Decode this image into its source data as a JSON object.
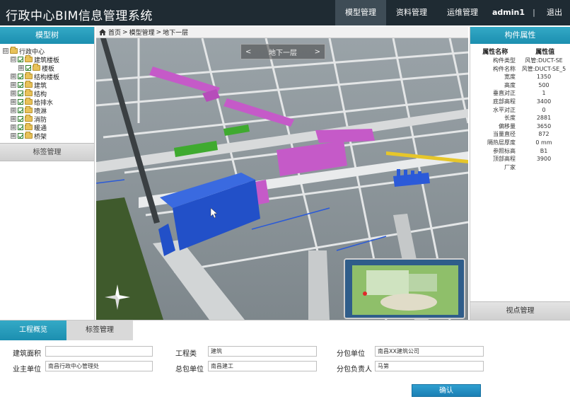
{
  "header": {
    "title": "行政中心BIM信息管理系统",
    "nav": [
      "模型管理",
      "资料管理",
      "运维管理"
    ],
    "active_nav": "模型管理",
    "user": "admin1",
    "separator": "|",
    "logout": "退出"
  },
  "left_panel": {
    "title": "模型树",
    "tree": [
      {
        "label": "行政中心",
        "level": 0,
        "toggle": "⊟",
        "checkbox": false
      },
      {
        "label": "建筑楼板",
        "level": 1,
        "toggle": "⊟",
        "checkbox": true
      },
      {
        "label": "楼板",
        "level": 2,
        "toggle": "⊞",
        "checkbox": true
      },
      {
        "label": "结构楼板",
        "level": 1,
        "toggle": "⊞",
        "checkbox": true
      },
      {
        "label": "建筑",
        "level": 1,
        "toggle": "⊞",
        "checkbox": true
      },
      {
        "label": "结构",
        "level": 1,
        "toggle": "⊞",
        "checkbox": true
      },
      {
        "label": "给排水",
        "level": 1,
        "toggle": "⊞",
        "checkbox": true
      },
      {
        "label": "喷淋",
        "level": 1,
        "toggle": "⊞",
        "checkbox": true
      },
      {
        "label": "消防",
        "level": 1,
        "toggle": "⊞",
        "checkbox": true
      },
      {
        "label": "暖通",
        "level": 1,
        "toggle": "⊞",
        "checkbox": true
      },
      {
        "label": "桥架",
        "level": 1,
        "toggle": "⊞",
        "checkbox": true
      }
    ],
    "tag_manage": "标签管理"
  },
  "breadcrumb": {
    "items": [
      "首页",
      "模型管理",
      "地下一层"
    ],
    "separator": ">"
  },
  "viewport": {
    "floor_label": "地下一层",
    "prev": "<",
    "next": ">"
  },
  "right_panel": {
    "title": "构件属性",
    "col_key": "属性名称",
    "col_val": "属性值",
    "rows": [
      {
        "k": "构件类型",
        "v": "风管:DUCT-SE"
      },
      {
        "k": "构件名称",
        "v": "风管:DUCT-SE_5"
      },
      {
        "k": "宽度",
        "v": "1350"
      },
      {
        "k": "高度",
        "v": "500"
      },
      {
        "k": "垂直对正",
        "v": "1"
      },
      {
        "k": "底部高程",
        "v": "3400"
      },
      {
        "k": "水平对正",
        "v": "0"
      },
      {
        "k": "长度",
        "v": "2881"
      },
      {
        "k": "偏移量",
        "v": "3650"
      },
      {
        "k": "当量直径",
        "v": "872"
      },
      {
        "k": "隔热层厚度",
        "v": "0 mm"
      },
      {
        "k": "参照标高",
        "v": "B1"
      },
      {
        "k": "顶部高程",
        "v": "3900"
      },
      {
        "k": "厂家",
        "v": ""
      }
    ],
    "view_manage": "视点管理"
  },
  "bottom": {
    "tabs": [
      "工程概览",
      "标签管理"
    ],
    "active_tab": "工程概览",
    "fields": {
      "area_label": "建筑面积",
      "area_value": "",
      "type_label": "工程类",
      "type_value": "建筑",
      "sub_label": "分包单位",
      "sub_value": "南昌XX建筑公司",
      "owner_label": "业主单位",
      "owner_value": "南昌行政中心管理处",
      "gc_label": "总包单位",
      "gc_value": "南昌建工",
      "subhead_label": "分包负责人",
      "subhead_value": "马第"
    },
    "confirm": "确认"
  },
  "colors": {
    "header_bg": "#1f2b33",
    "panel_accent": "#1c8fb0",
    "duct_blue": "#2250c8",
    "duct_magenta": "#c55ac8",
    "confirm_button": "#1b7fb4"
  },
  "icons": {
    "home": "home-icon",
    "compass": "compass-icon",
    "folder": "folder-icon",
    "checkbox": "checkbox-icon"
  }
}
